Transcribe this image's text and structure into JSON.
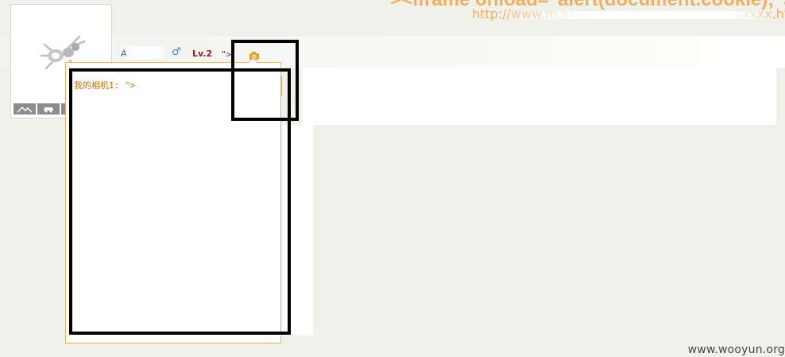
{
  "header": {
    "payload_text": "\"><iframe onload=\"alert(document.cookie);\">",
    "url_text": "http://www.m.xxxxxxxxxxxxxxxxxxxxxxxxxxxx.html"
  },
  "profile": {
    "nickname": "A",
    "gender_symbol": "♂",
    "level": "Lv.2",
    "suffix": "\">"
  },
  "popup": {
    "label": "我的相机1: \">"
  },
  "watermark": "www.wooyun.org",
  "colors": {
    "accent_orange": "#f0b060",
    "level_red": "#9b1c1c",
    "gender_blue": "#2c8fd2"
  },
  "icons": {
    "avatar": "ant-avatar-icon",
    "camera": "camera-icon",
    "avatar_bar": [
      "photo-album-icon",
      "car-icon"
    ]
  }
}
